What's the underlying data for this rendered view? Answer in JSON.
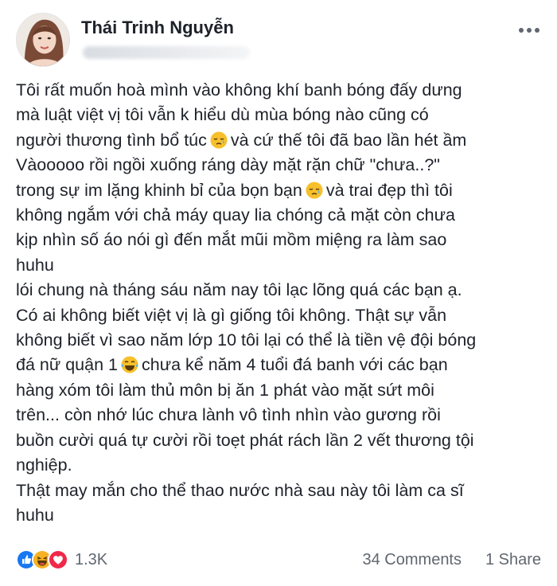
{
  "post": {
    "author": "Thái Trinh Nguyễn",
    "lines": [
      {
        "text": "Tôi rất muốn hoà mình vào không khí banh bóng đấy dưng"
      },
      {
        "text": "mà luật việt vị tôi vẫn k hiểu dù mùa bóng nào cũng có"
      },
      {
        "text": "người thương tình bổ túc",
        "emoji": "sleepy-emoji",
        "after": "và cứ thế tôi đã bao lần hét ầm"
      },
      {
        "text": "Vàooooo rồi ngồi xuống ráng dày mặt rặn chữ \"chưa..?\""
      },
      {
        "text": "trong sự im lặng khinh bỉ của bọn bạn",
        "emoji": "sleepy-emoji",
        "after": "và trai đẹp thì tôi"
      },
      {
        "text": "không ngắm với chả máy quay lia chóng cả mặt còn chưa"
      },
      {
        "text": "kịp nhìn số áo nói gì đến mắt mũi mồm miệng ra làm sao"
      },
      {
        "text": "huhu"
      },
      {
        "text": "lói chung nà tháng sáu năm nay tôi lạc lõng quá các bạn ạ."
      },
      {
        "text": "Có ai không biết việt vị là gì giống tôi không. Thật sự vẫn"
      },
      {
        "text": "không biết vì sao năm lớp 10 tôi lại có thể là tiền vệ đội bóng"
      },
      {
        "text": "đá nữ quận 1",
        "emoji": "tears-of-joy-emoji",
        "after": "chưa kể năm 4 tuổi đá banh với các bạn"
      },
      {
        "text": "hàng xóm tôi làm thủ môn bị ăn 1 phát vào mặt sứt môi"
      },
      {
        "text": "trên... còn nhớ lúc chưa lành vô tình nhìn vào gương rồi"
      },
      {
        "text": "buồn cười quá tự cười rồi toẹt phát rách lần 2 vết thương tội"
      },
      {
        "text": "nghiệp."
      },
      {
        "text": "Thật may mắn cho thể thao nước nhà sau này tôi làm ca sĩ"
      },
      {
        "text": "huhu"
      }
    ]
  },
  "footer": {
    "reaction_icons": [
      "like-icon",
      "haha-icon",
      "love-icon"
    ],
    "reaction_count": "1.3K",
    "comments": "34 Comments",
    "shares": "1 Share"
  },
  "colors": {
    "text": "#1d2129",
    "secondary": "#606770",
    "like": "#1877f2",
    "love": "#f0284a",
    "haha": "#f7b125"
  }
}
